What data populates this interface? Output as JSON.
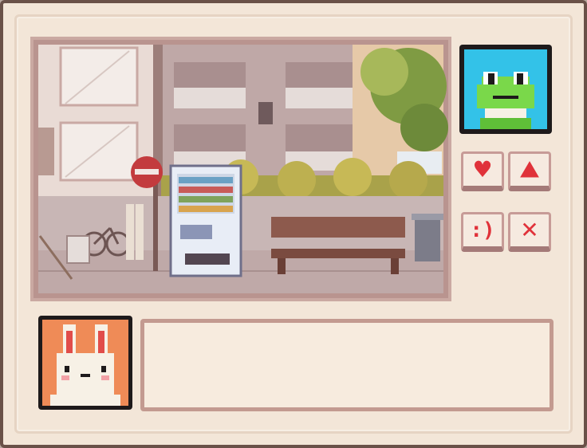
{
  "scene": {
    "name": "street-scene-vending-machine"
  },
  "portrait": {
    "character": "frog",
    "icon": "frog-face-icon"
  },
  "actions": [
    {
      "id": "heart",
      "icon": "heart-icon",
      "glyph": "♥"
    },
    {
      "id": "scene",
      "icon": "mountain-icon",
      "glyph": "⛰"
    },
    {
      "id": "smile",
      "icon": "smile-icon",
      "glyph": ":)"
    },
    {
      "id": "close",
      "icon": "close-icon",
      "glyph": "✕"
    }
  ],
  "speaker": {
    "character": "rabbit",
    "icon": "rabbit-face-icon"
  },
  "dialog": {
    "text": ""
  },
  "colors": {
    "accent": "#e0323a",
    "frame": "#6a5148",
    "panel": "#f3e6d8",
    "portrait_bg": "#33c2e8",
    "speaker_bg": "#ef8b57"
  }
}
